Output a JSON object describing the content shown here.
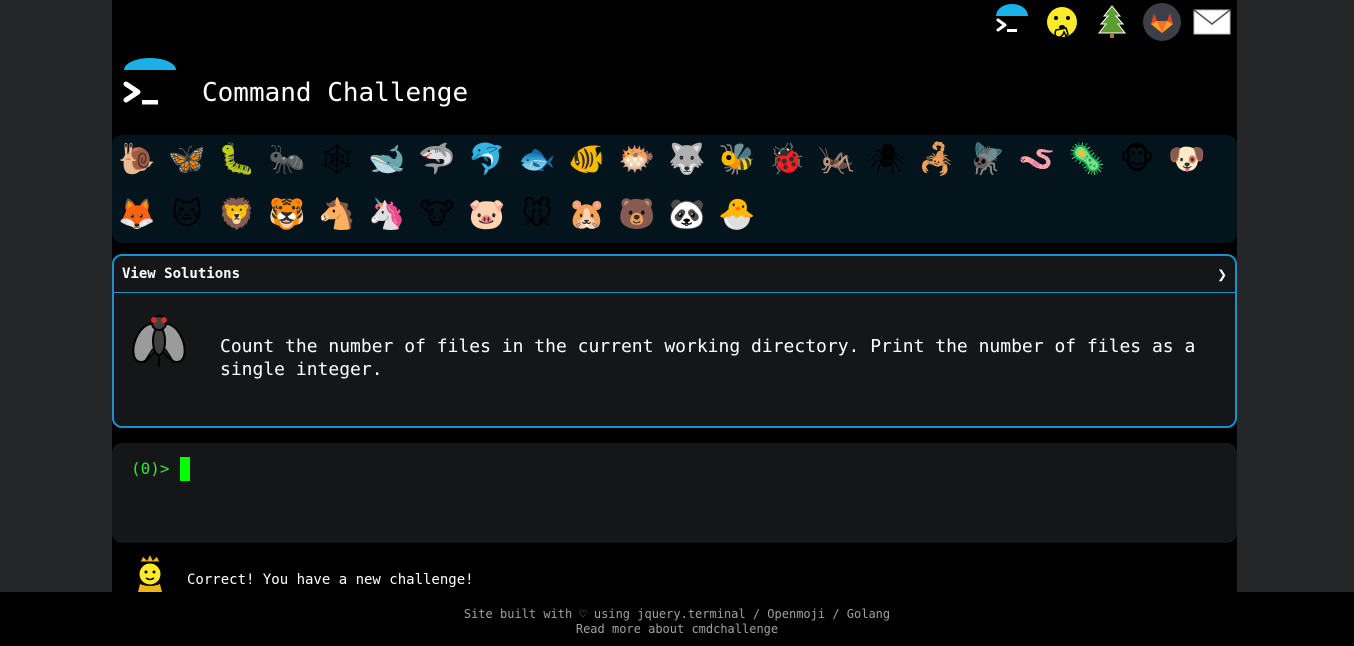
{
  "header": {
    "title": "Command Challenge",
    "logo_icon": "terminal-prompt-icon",
    "top_icons": [
      {
        "name": "terminal-logo-icon"
      },
      {
        "name": "shushing-face-icon"
      },
      {
        "name": "evergreen-tree-icon"
      },
      {
        "name": "gitlab-fox-icon"
      },
      {
        "name": "envelope-icon"
      }
    ]
  },
  "challenges": {
    "row1": [
      {
        "name": "snail",
        "glyph": "🐌"
      },
      {
        "name": "butterfly",
        "glyph": "🦋"
      },
      {
        "name": "caterpillar",
        "glyph": "🐛"
      },
      {
        "name": "ant",
        "glyph": "🐜"
      },
      {
        "name": "spider-web",
        "glyph": "🕸"
      },
      {
        "name": "whale",
        "glyph": "🐋"
      },
      {
        "name": "shark",
        "glyph": "🦈"
      },
      {
        "name": "dolphin",
        "glyph": "🐬"
      },
      {
        "name": "fish",
        "glyph": "🐟"
      },
      {
        "name": "tropical-fish",
        "glyph": "🐠"
      },
      {
        "name": "blowfish",
        "glyph": "🐡"
      },
      {
        "name": "wolf",
        "glyph": "🐺"
      },
      {
        "name": "bee",
        "glyph": "🐝"
      },
      {
        "name": "ladybug",
        "glyph": "🐞"
      },
      {
        "name": "cricket",
        "glyph": "🦗"
      },
      {
        "name": "spider",
        "glyph": "🕷"
      },
      {
        "name": "scorpion",
        "glyph": "🦂"
      },
      {
        "name": "fly",
        "glyph": "🪰"
      },
      {
        "name": "worm",
        "glyph": "🪱"
      },
      {
        "name": "microbe",
        "glyph": "🦠"
      },
      {
        "name": "monkey",
        "glyph": "🐵"
      },
      {
        "name": "dog",
        "glyph": "🐶"
      }
    ],
    "row2": [
      {
        "name": "fox",
        "glyph": "🦊"
      },
      {
        "name": "cat",
        "glyph": "🐱"
      },
      {
        "name": "lion",
        "glyph": "🦁"
      },
      {
        "name": "tiger",
        "glyph": "🐯"
      },
      {
        "name": "horse",
        "glyph": "🐴"
      },
      {
        "name": "unicorn",
        "glyph": "🦄"
      },
      {
        "name": "cow",
        "glyph": "🐮"
      },
      {
        "name": "pig",
        "glyph": "🐷"
      },
      {
        "name": "mouse",
        "glyph": "🐭"
      },
      {
        "name": "hamster",
        "glyph": "🐹"
      },
      {
        "name": "bear",
        "glyph": "🐻"
      },
      {
        "name": "panda",
        "glyph": "🐼"
      },
      {
        "name": "hatching-chick",
        "glyph": "🐣"
      }
    ]
  },
  "panel": {
    "header": "View Solutions",
    "chevron": "❯",
    "icon": "fly-icon",
    "question": "Count the number of files in the current working directory. Print the number of files as a single integer."
  },
  "terminal": {
    "prompt": "(0)>"
  },
  "status": {
    "icon": "princess-icon",
    "text": "Correct! You have a new challenge!"
  },
  "footer": {
    "line1": "Site built with ♡ using jquery.terminal / Openmoji / Golang",
    "line2": "Read more about cmdchallenge"
  }
}
